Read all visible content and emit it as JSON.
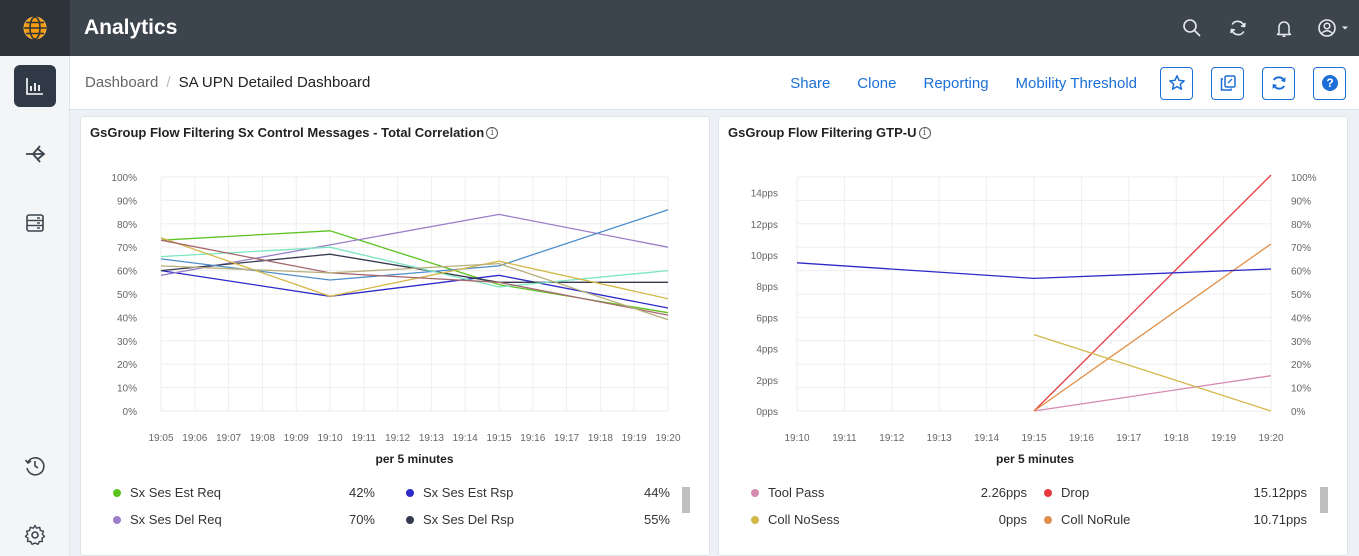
{
  "app": {
    "title": "Analytics"
  },
  "breadcrumb": {
    "root": "Dashboard",
    "separator": "/",
    "current": "SA UPN Detailed Dashboard"
  },
  "actions": {
    "share": "Share",
    "clone": "Clone",
    "reporting": "Reporting",
    "mobility": "Mobility Threshold"
  },
  "colors": {
    "topbar": "#3c444d",
    "accent": "#1c6fd6"
  },
  "panels": {
    "left": {
      "title": "GsGroup Flow Filtering Sx Control Messages - Total Correlation",
      "info": "i",
      "xlabel": "per 5 minutes",
      "legend": [
        {
          "name": "Sx Ses Est Req",
          "value": "42%",
          "color": "#5cc21e"
        },
        {
          "name": "Sx Ses Est Rsp",
          "value": "44%",
          "color": "#2e2ac8"
        },
        {
          "name": "Sx Ses Del Req",
          "value": "70%",
          "color": "#9b7fc8"
        },
        {
          "name": "Sx Ses Del Rsp",
          "value": "55%",
          "color": "#363a4e"
        }
      ]
    },
    "right": {
      "title": "GsGroup Flow Filtering GTP-U",
      "info": "i",
      "xlabel": "per 5 minutes",
      "legend": [
        {
          "name": "Tool Pass",
          "value": "2.26pps",
          "color": "#d68ab0"
        },
        {
          "name": "Drop",
          "value": "15.12pps",
          "color": "#e8383d"
        },
        {
          "name": "Coll NoSess",
          "value": "0pps",
          "color": "#d4b84a"
        },
        {
          "name": "Coll NoRule",
          "value": "10.71pps",
          "color": "#e0914a"
        }
      ]
    }
  },
  "chart_data": [
    {
      "type": "line",
      "title": "GsGroup Flow Filtering Sx Control Messages - Total Correlation",
      "xlabel": "per 5 minutes",
      "x": [
        "19:05",
        "19:06",
        "19:07",
        "19:08",
        "19:09",
        "19:10",
        "19:11",
        "19:12",
        "19:13",
        "19:14",
        "19:15",
        "19:16",
        "19:17",
        "19:18",
        "19:19",
        "19:20"
      ],
      "y_ticks": [
        "0%",
        "10%",
        "20%",
        "30%",
        "40%",
        "50%",
        "60%",
        "70%",
        "80%",
        "90%",
        "100%"
      ],
      "ylim": [
        0,
        100
      ],
      "sample_x": [
        "19:05",
        "19:10",
        "19:15",
        "19:20"
      ],
      "series": [
        {
          "name": "Sx Ses Est Req",
          "color": "#5cc21e",
          "values": [
            73,
            77,
            54,
            42
          ]
        },
        {
          "name": "Sx Ses Est Rsp",
          "color": "#2e2ac8",
          "values": [
            60,
            49,
            58,
            44
          ]
        },
        {
          "name": "Sx Ses Del Req",
          "color": "#9b7fc8",
          "values": [
            58,
            71,
            84,
            70
          ]
        },
        {
          "name": "Sx Ses Del Rsp",
          "color": "#363a4e",
          "values": [
            60,
            67,
            55,
            55
          ]
        },
        {
          "color": "#4e8ec8",
          "values": [
            65,
            56,
            62,
            86
          ]
        },
        {
          "color": "#7de6c0",
          "values": [
            66,
            70,
            53,
            60
          ]
        },
        {
          "color": "#d4b84a",
          "values": [
            74,
            49,
            64,
            48
          ]
        },
        {
          "color": "#a86870",
          "values": [
            73,
            59,
            55,
            41
          ]
        },
        {
          "color": "#b8ae7c",
          "values": [
            62,
            59,
            63,
            39
          ]
        }
      ],
      "legend": "bottom",
      "grid": true
    },
    {
      "type": "line",
      "title": "GsGroup Flow Filtering GTP-U",
      "xlabel": "per 5 minutes",
      "x": [
        "19:10",
        "19:11",
        "19:12",
        "19:13",
        "19:14",
        "19:15",
        "19:16",
        "19:17",
        "19:18",
        "19:19",
        "19:20"
      ],
      "y_ticks_left": [
        "0pps",
        "2pps",
        "4pps",
        "6pps",
        "8pps",
        "10pps",
        "12pps",
        "14pps"
      ],
      "ylim_left": [
        0,
        15
      ],
      "y_ticks_right": [
        "0%",
        "10%",
        "20%",
        "30%",
        "40%",
        "50%",
        "60%",
        "70%",
        "80%",
        "90%",
        "100%"
      ],
      "ylim_right": [
        0,
        100
      ],
      "sample_x": [
        "19:10",
        "19:15",
        "19:20"
      ],
      "series": [
        {
          "name": "Tool Pass",
          "color": "#d68ab0",
          "values": [
            null,
            0,
            2.26
          ]
        },
        {
          "name": "Drop",
          "color": "#e8383d",
          "values": [
            null,
            0,
            15.12
          ]
        },
        {
          "name": "Coll NoSess",
          "color": "#d4b84a",
          "values": [
            null,
            4.9,
            0
          ]
        },
        {
          "name": "Coll NoRule",
          "color": "#e0914a",
          "values": [
            null,
            0,
            10.71
          ]
        },
        {
          "color": "#2e2ac8",
          "values": [
            9.5,
            8.5,
            9.1
          ]
        }
      ],
      "legend": "bottom",
      "grid": true
    }
  ]
}
